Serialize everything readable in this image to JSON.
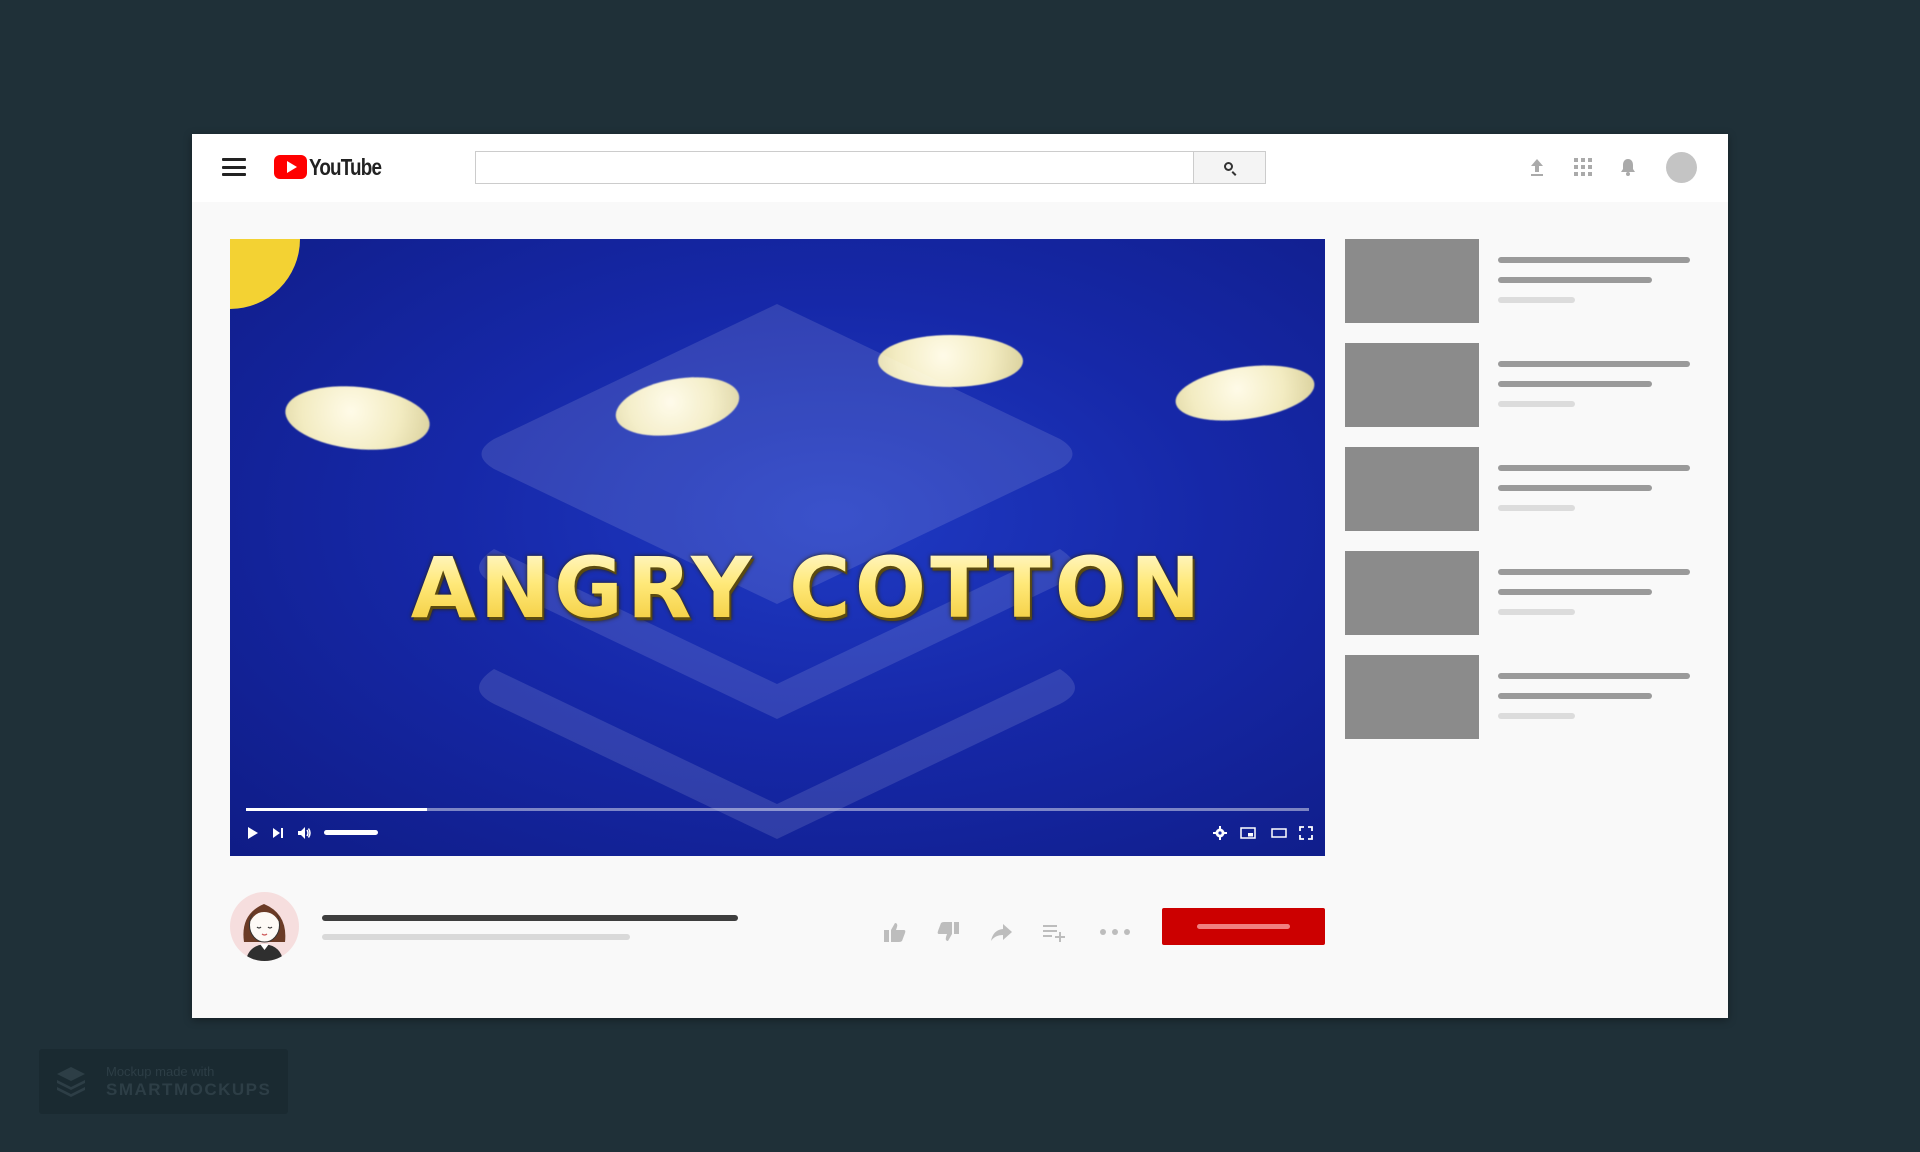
{
  "app": {
    "logo_text": "YouTube"
  },
  "search": {
    "value": "",
    "placeholder": ""
  },
  "player": {
    "video_title_overlay": "ANGRY COTTON",
    "progress_fraction": 0.17,
    "volume_fraction": 1.0
  },
  "icons": {
    "menu": "hamburger-menu-icon",
    "search": "magnifier-icon",
    "upload": "upload-arrow-icon",
    "apps": "grid-apps-icon",
    "notifications": "bell-icon",
    "play": "play-icon",
    "next": "skip-next-icon",
    "volume": "speaker-icon",
    "settings": "gear-icon",
    "miniplayer": "miniplayer-icon",
    "theater": "theater-mode-icon",
    "fullscreen": "fullscreen-icon",
    "like": "thumbs-up-icon",
    "dislike": "thumbs-down-icon",
    "share": "share-arrow-icon",
    "add_to_playlist": "playlist-add-icon",
    "more": "more-dots-icon"
  },
  "recommendations_count": 5,
  "colors": {
    "background": "#1f3038",
    "brand_red": "#ff0000",
    "subscribe_red": "#cc0000",
    "video_blue": "#1628a8",
    "placeholder_gray": "#8b8b8b"
  },
  "badge": {
    "line1": "Mockup made with",
    "line2": "SMARTMOCKUPS"
  }
}
